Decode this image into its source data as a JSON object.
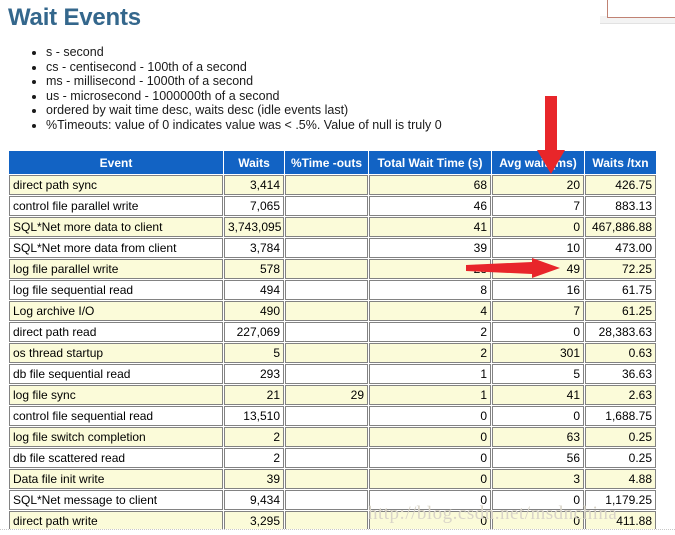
{
  "page": {
    "title": "Wait Events",
    "watermark": "http://blog.csdn.net/msdnchina"
  },
  "top_right_widget": {
    "glyph": "◡"
  },
  "notes": [
    "s - second",
    "cs - centisecond - 100th of a second",
    "ms - millisecond - 1000th of a second",
    "us - microsecond - 1000000th of a second",
    "ordered by wait time desc, waits desc (idle events last)",
    "%Timeouts: value of 0 indicates value was < .5%. Value of null is truly 0"
  ],
  "table": {
    "headers": [
      "Event",
      "Waits",
      "%Time -outs",
      "Total Wait Time (s)",
      "Avg wait (ms)",
      "Waits /txn"
    ],
    "rows": [
      {
        "event": "direct path sync",
        "waits": "3,414",
        "timeouts": "",
        "total_wait_s": "68",
        "avg_wait_ms": "20",
        "waits_txn": "426.75"
      },
      {
        "event": "control file parallel write",
        "waits": "7,065",
        "timeouts": "",
        "total_wait_s": "46",
        "avg_wait_ms": "7",
        "waits_txn": "883.13"
      },
      {
        "event": "SQL*Net more data to client",
        "waits": "3,743,095",
        "timeouts": "",
        "total_wait_s": "41",
        "avg_wait_ms": "0",
        "waits_txn": "467,886.88"
      },
      {
        "event": "SQL*Net more data from client",
        "waits": "3,784",
        "timeouts": "",
        "total_wait_s": "39",
        "avg_wait_ms": "10",
        "waits_txn": "473.00"
      },
      {
        "event": "log file parallel write",
        "waits": "578",
        "timeouts": "",
        "total_wait_s": "28",
        "avg_wait_ms": "49",
        "waits_txn": "72.25"
      },
      {
        "event": "log file sequential read",
        "waits": "494",
        "timeouts": "",
        "total_wait_s": "8",
        "avg_wait_ms": "16",
        "waits_txn": "61.75"
      },
      {
        "event": "Log archive I/O",
        "waits": "490",
        "timeouts": "",
        "total_wait_s": "4",
        "avg_wait_ms": "7",
        "waits_txn": "61.25"
      },
      {
        "event": "direct path read",
        "waits": "227,069",
        "timeouts": "",
        "total_wait_s": "2",
        "avg_wait_ms": "0",
        "waits_txn": "28,383.63"
      },
      {
        "event": "os thread startup",
        "waits": "5",
        "timeouts": "",
        "total_wait_s": "2",
        "avg_wait_ms": "301",
        "waits_txn": "0.63"
      },
      {
        "event": "db file sequential read",
        "waits": "293",
        "timeouts": "",
        "total_wait_s": "1",
        "avg_wait_ms": "5",
        "waits_txn": "36.63"
      },
      {
        "event": "log file sync",
        "waits": "21",
        "timeouts": "29",
        "total_wait_s": "1",
        "avg_wait_ms": "41",
        "waits_txn": "2.63"
      },
      {
        "event": "control file sequential read",
        "waits": "13,510",
        "timeouts": "",
        "total_wait_s": "0",
        "avg_wait_ms": "0",
        "waits_txn": "1,688.75"
      },
      {
        "event": "log file switch completion",
        "waits": "2",
        "timeouts": "",
        "total_wait_s": "0",
        "avg_wait_ms": "63",
        "waits_txn": "0.25"
      },
      {
        "event": "db file scattered read",
        "waits": "2",
        "timeouts": "",
        "total_wait_s": "0",
        "avg_wait_ms": "56",
        "waits_txn": "0.25"
      },
      {
        "event": "Data file init write",
        "waits": "39",
        "timeouts": "",
        "total_wait_s": "0",
        "avg_wait_ms": "3",
        "waits_txn": "4.88"
      },
      {
        "event": "SQL*Net message to client",
        "waits": "9,434",
        "timeouts": "",
        "total_wait_s": "0",
        "avg_wait_ms": "0",
        "waits_txn": "1,179.25"
      },
      {
        "event": "direct path write",
        "waits": "3,295",
        "timeouts": "",
        "total_wait_s": "0",
        "avg_wait_ms": "0",
        "waits_txn": "411.88"
      }
    ]
  },
  "annotations": {
    "color": "#e8262a",
    "down_arrow_target": "Avg wait (ms)",
    "right_arrow_target": "49"
  },
  "colors": {
    "title": "#34678c",
    "header_bg": "#1263c4",
    "row_alt_bg": "#fbfbd9",
    "arrow_red": "#e8262a"
  }
}
